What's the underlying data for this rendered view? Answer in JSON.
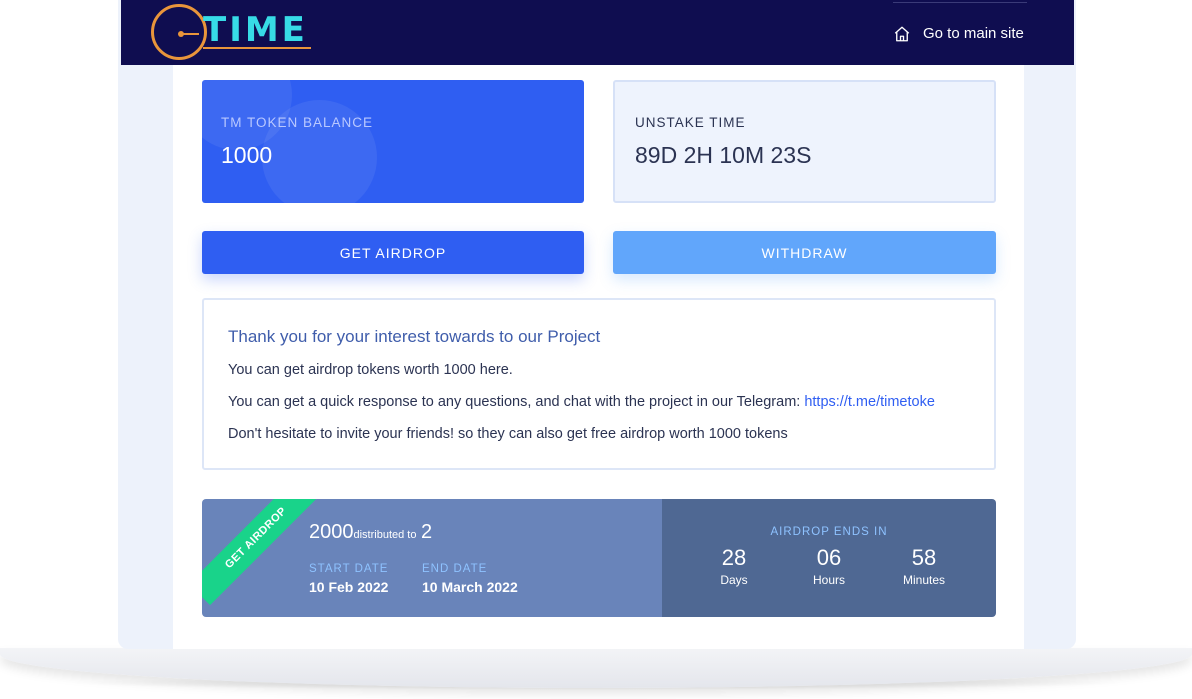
{
  "app": {
    "logo_text": "TIME",
    "nav_link_label": "Go to main site"
  },
  "cards": {
    "balance": {
      "label": "TM TOKEN BALANCE",
      "value": "1000"
    },
    "unstake": {
      "label": "UNSTAKE TIME",
      "value": "89D 2H 10M 23S"
    }
  },
  "buttons": {
    "get_airdrop": "GET AIRDROP",
    "withdraw": "WITHDRAW"
  },
  "info": {
    "title": "Thank you for your interest towards to our Project",
    "line1": "You can get airdrop tokens worth 1000 here.",
    "line2_prefix": "You can get a quick response to any questions, and chat with the project in our Telegram: ",
    "line2_link": "https://t.me/timetoke",
    "line3": "Don't hesitate to invite your friends! so they can also get free airdrop worth 1000 tokens"
  },
  "airdrop": {
    "ribbon": "GET AIRDROP",
    "total": "2000",
    "distributed_text": "distributed to",
    "recipients": "2",
    "start_label": "START DATE",
    "start_value": "10 Feb 2022",
    "end_label": "END DATE",
    "end_value": "10 March 2022",
    "ends_in_label": "AIRDROP ENDS IN",
    "countdown": [
      {
        "value": "28",
        "unit": "Days"
      },
      {
        "value": "06",
        "unit": "Hours"
      },
      {
        "value": "58",
        "unit": "Minutes"
      }
    ]
  },
  "colors": {
    "navbar": "#0f0d50",
    "logo_accent": "#37dbe6",
    "logo_clock": "#e9953b",
    "primary": "#2f5ef2",
    "secondary": "#61a6fb",
    "ribbon": "#19d38a"
  },
  "icons": {
    "logo": "clock-icon",
    "nav": "home-icon"
  }
}
